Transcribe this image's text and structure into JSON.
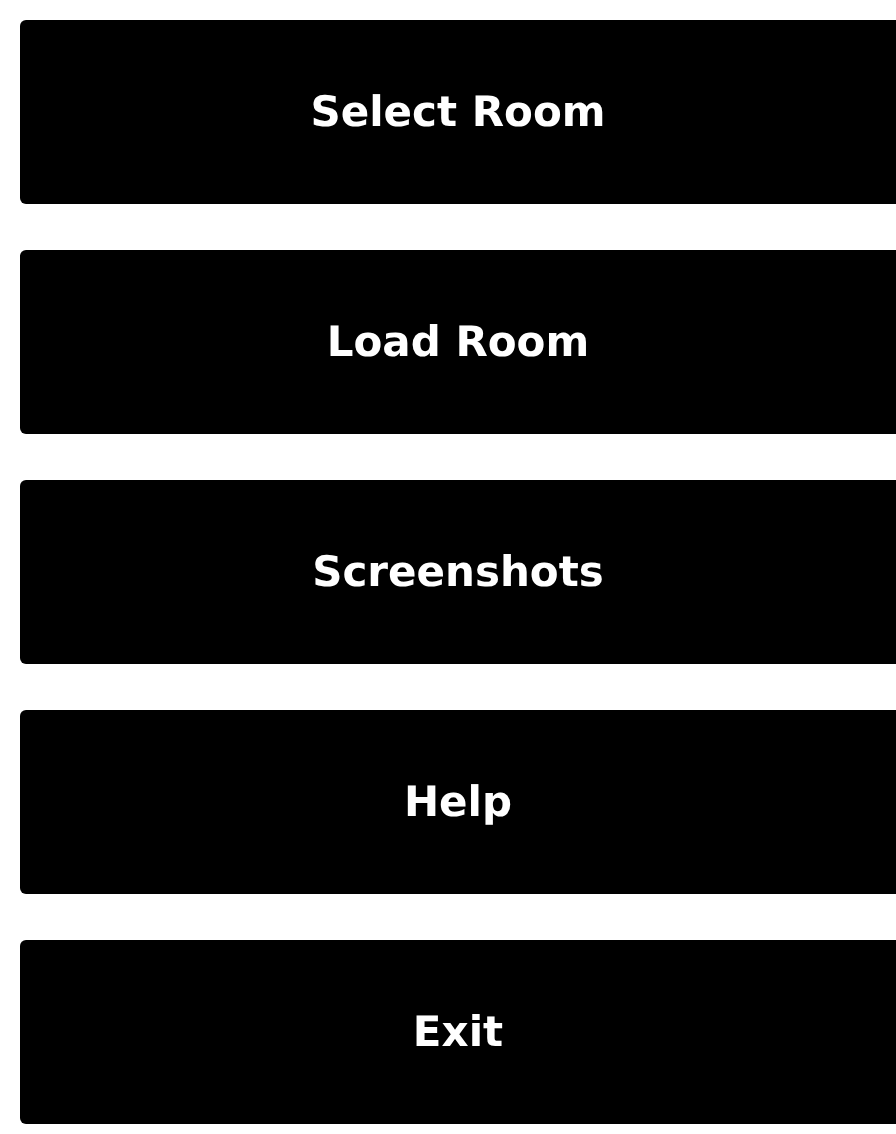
{
  "buttons": [
    {
      "label": "Select Room"
    },
    {
      "label": "Load Room"
    },
    {
      "label": "Screenshots"
    },
    {
      "label": "Help"
    },
    {
      "label": "Exit"
    }
  ]
}
